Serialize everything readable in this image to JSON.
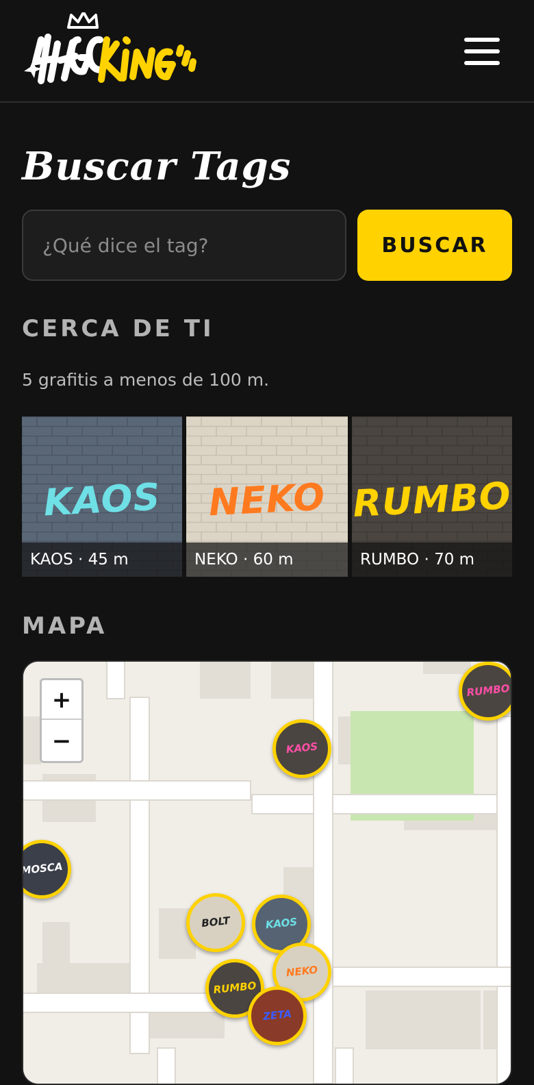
{
  "header": {
    "logo_text": "TagKing",
    "menu_icon": "hamburger-icon"
  },
  "page": {
    "title": "Buscar Tags"
  },
  "search": {
    "placeholder": "¿Qué dice el tag?",
    "value": "",
    "button_label": "BUSCAR"
  },
  "nearby": {
    "heading": "CERCA DE TI",
    "summary": "5 grafitis a menos de 100 m.",
    "cards": [
      {
        "tag": "KAOS",
        "caption": "KAOS · 45 m",
        "tag_color": "#6ee0e6",
        "wall_color": "#566373"
      },
      {
        "tag": "NEKO",
        "caption": "NEKO · 60 m",
        "tag_color": "#ff7a1f",
        "wall_color": "#d8d1c2"
      },
      {
        "tag": "RUMBO",
        "caption": "RUMBO · 70 m",
        "tag_color": "#ffd200",
        "wall_color": "#4a4540"
      }
    ]
  },
  "map": {
    "heading": "MAPA",
    "zoom_in_label": "+",
    "zoom_out_label": "−",
    "markers": [
      {
        "tag": "RUMBO",
        "text_color": "#ff4fa8",
        "fill": "#4a4540"
      },
      {
        "tag": "KAOS",
        "text_color": "#ff4fa8",
        "fill": "#4a4540"
      },
      {
        "tag": "MOSCA",
        "text_color": "#ffffff",
        "fill": "#3a3f4a"
      },
      {
        "tag": "BOLT",
        "text_color": "#222222",
        "fill": "#d8d1c2"
      },
      {
        "tag": "KAOS",
        "text_color": "#6ee0e6",
        "fill": "#566373"
      },
      {
        "tag": "NEKO",
        "text_color": "#ff7a1f",
        "fill": "#d8d1c2"
      },
      {
        "tag": "RUMBO",
        "text_color": "#ffd200",
        "fill": "#4a4540"
      },
      {
        "tag": "ZETA",
        "text_color": "#3a5cff",
        "fill": "#8a3a28"
      }
    ]
  },
  "colors": {
    "accent": "#ffd200",
    "background": "#121212",
    "map_park": "#c8e6b0"
  }
}
